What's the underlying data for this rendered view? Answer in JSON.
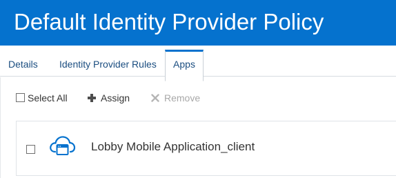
{
  "header": {
    "title": "Default Identity Provider Policy"
  },
  "tabs": [
    {
      "label": "Details",
      "active": false
    },
    {
      "label": "Identity Provider Rules",
      "active": false
    },
    {
      "label": "Apps",
      "active": true
    }
  ],
  "toolbar": {
    "select_all_label": "Select All",
    "assign_label": "Assign",
    "remove_label": "Remove",
    "remove_enabled": false
  },
  "apps": [
    {
      "name": "Lobby Mobile Application_client",
      "checked": false,
      "icon": "cloud-app-icon"
    }
  ],
  "colors": {
    "header_bg": "#0572ce",
    "tab_text": "#1a4d80",
    "active_tab_accent": "#0572ce",
    "icon_blue": "#0572ce",
    "disabled_text": "#a8a8a8"
  }
}
